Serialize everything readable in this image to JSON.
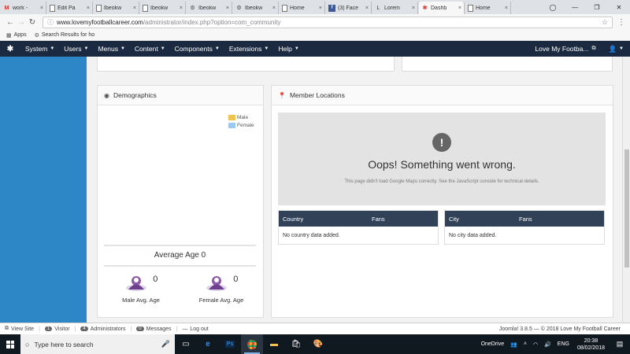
{
  "browser": {
    "tabs": [
      {
        "label": "work -",
        "icon": "gmail-icon",
        "active": false
      },
      {
        "label": "Edit Pa",
        "icon": "document-icon",
        "active": false
      },
      {
        "label": "Ibeokw",
        "icon": "document-icon",
        "active": false
      },
      {
        "label": "Ibeokw",
        "icon": "document-icon",
        "active": false
      },
      {
        "label": "Ibeokw",
        "icon": "gear-icon",
        "active": false
      },
      {
        "label": "Ibeokw",
        "icon": "gear-icon",
        "active": false
      },
      {
        "label": "Home",
        "icon": "document-icon",
        "active": false
      },
      {
        "label": "(3) Face",
        "icon": "facebook-icon",
        "active": false
      },
      {
        "label": "Lorem",
        "icon": "lorem-icon",
        "active": false
      },
      {
        "label": "Dashb",
        "icon": "joomla-icon",
        "active": true
      },
      {
        "label": "Home",
        "icon": "document-icon",
        "active": false
      }
    ],
    "url_host": "www.lovemyfootballcareer.com",
    "url_path": "/administrator/index.php?option=com_community",
    "bookmarks": [
      {
        "label": "Apps",
        "icon": "apps-icon"
      },
      {
        "label": "Search Results for ho",
        "icon": "gear-icon"
      }
    ]
  },
  "admin_nav": {
    "items": [
      "System",
      "Users",
      "Menus",
      "Content",
      "Components",
      "Extensions",
      "Help"
    ],
    "site_name": "Love My Footba...",
    "user_icon": "user-icon"
  },
  "demographics": {
    "title": "Demographics",
    "legend": [
      {
        "label": "Male",
        "color": "#f0c34c"
      },
      {
        "label": "Female",
        "color": "#9cc9ef"
      }
    ],
    "average_age_label": "Average Age 0",
    "male_avg_value": "0",
    "male_avg_label": "Male Avg. Age",
    "female_avg_value": "0",
    "female_avg_label": "Female Avg. Age"
  },
  "member_locations": {
    "title": "Member Locations",
    "map_error_title": "Oops! Something went wrong.",
    "map_error_detail": "This page didn't load Google Maps correctly. See the JavaScript console for technical details.",
    "country_table": {
      "col1": "Country",
      "col2": "Fans",
      "empty": "No country data added."
    },
    "city_table": {
      "col1": "City",
      "col2": "Fans",
      "empty": "No city data added."
    }
  },
  "status_bar": {
    "view_site": "View Site",
    "visitor_count": "1",
    "visitor_label": "Visitor",
    "admin_count": "4",
    "admin_label": "Administrators",
    "messages_count": "0",
    "messages_label": "Messages",
    "logout": "Log out",
    "footer": "Joomla! 3.8.5 — © 2018 Love My Football Career"
  },
  "taskbar": {
    "search_placeholder": "Type here to search",
    "onedrive": "OneDrive",
    "language": "ENG",
    "time": "20:38",
    "date": "08/02/2018"
  },
  "colors": {
    "sidebar": "#2d86c6",
    "navbar": "#1b2a40",
    "table_header": "#314158"
  }
}
